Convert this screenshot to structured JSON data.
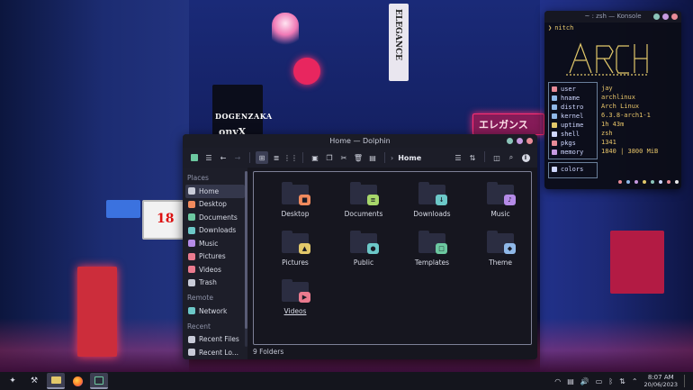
{
  "wallpaper": {
    "signs": [
      "DOGENZAKA",
      "onyX",
      "エレガンス",
      "18",
      "ELEGANCE"
    ]
  },
  "konsole": {
    "title": "~ : zsh — Konsole",
    "prompt_symbol": "❯",
    "command": "nitch",
    "window_button_colors": [
      "#8bc4b9",
      "#c79ae0",
      "#e88b97"
    ],
    "info": [
      {
        "key": "user",
        "icon": "user-icon",
        "color": "#e88b97",
        "value": "jay"
      },
      {
        "key": "hname",
        "icon": "hash-icon",
        "color": "#8fb8e8",
        "value": "archlinux"
      },
      {
        "key": "distro",
        "icon": "distro-icon",
        "color": "#8fb8e8",
        "value": "Arch Linux"
      },
      {
        "key": "kernel",
        "icon": "kernel-icon",
        "color": "#8fb8e8",
        "value": "6.3.8-arch1-1"
      },
      {
        "key": "uptime",
        "icon": "clock-icon",
        "color": "#e2c86a",
        "value": "1h 43m"
      },
      {
        "key": "shell",
        "icon": "shell-icon",
        "color": "#cfd7ff",
        "value": "zsh"
      },
      {
        "key": "pkgs",
        "icon": "package-icon",
        "color": "#e88b97",
        "value": "1341"
      },
      {
        "key": "memory",
        "icon": "memory-icon",
        "color": "#c79ae0",
        "value": "1840 | 3800 MiB"
      }
    ],
    "colors_label": "colors",
    "swatches": [
      "#e88b97",
      "#8fb8e8",
      "#c79ae0",
      "#e2c86a",
      "#8bc4b9",
      "#cfd7ff",
      "#e88b97",
      "#eaeaea"
    ]
  },
  "dolphin": {
    "title": "Home — Dolphin",
    "window_button_colors": [
      "#8bc4b9",
      "#c79ae0",
      "#e88b97"
    ],
    "path": "Home",
    "places_label": "Places",
    "places": [
      {
        "label": "Home",
        "icon": "home-icon",
        "color": "#c8cbd8",
        "selected": true
      },
      {
        "label": "Desktop",
        "icon": "desktop-icon",
        "color": "#f08a5d",
        "selected": false
      },
      {
        "label": "Documents",
        "icon": "documents-icon",
        "color": "#6cc8a0",
        "selected": false
      },
      {
        "label": "Downloads",
        "icon": "downloads-icon",
        "color": "#6cc8c8",
        "selected": false
      },
      {
        "label": "Music",
        "icon": "music-icon",
        "color": "#b58be8",
        "selected": false
      },
      {
        "label": "Pictures",
        "icon": "pictures-icon",
        "color": "#ea7a8e",
        "selected": false
      },
      {
        "label": "Videos",
        "icon": "videos-icon",
        "color": "#ea7a8e",
        "selected": false
      },
      {
        "label": "Trash",
        "icon": "trash-icon",
        "color": "#c8cbd8",
        "selected": false
      }
    ],
    "remote_label": "Remote",
    "remote": [
      {
        "label": "Network",
        "icon": "network-icon",
        "color": "#6cc8c8"
      }
    ],
    "recent_label": "Recent",
    "recent": [
      {
        "label": "Recent Files",
        "icon": "recent-files-icon",
        "color": "#c8cbd8"
      },
      {
        "label": "Recent Lo...",
        "icon": "recent-locations-icon",
        "color": "#c8cbd8"
      }
    ],
    "folders": [
      {
        "label": "Desktop",
        "icon": "desktop-folder-icon",
        "badge_color": "#f08a5d",
        "glyph": "■"
      },
      {
        "label": "Documents",
        "icon": "documents-folder-icon",
        "badge_color": "#a7d76a",
        "glyph": "≡"
      },
      {
        "label": "Downloads",
        "icon": "downloads-folder-icon",
        "badge_color": "#6cc8c8",
        "glyph": "↓"
      },
      {
        "label": "Music",
        "icon": "music-folder-icon",
        "badge_color": "#b58be8",
        "glyph": "♪"
      },
      {
        "label": "Pictures",
        "icon": "pictures-folder-icon",
        "badge_color": "#e2c86a",
        "glyph": "▲"
      },
      {
        "label": "Public",
        "icon": "public-folder-icon",
        "badge_color": "#6cc8c8",
        "glyph": "●"
      },
      {
        "label": "Templates",
        "icon": "templates-folder-icon",
        "badge_color": "#6cc8a0",
        "glyph": "□"
      },
      {
        "label": "Theme",
        "icon": "theme-folder-icon",
        "badge_color": "#8fb8e8",
        "glyph": "◆"
      },
      {
        "label": "Videos",
        "icon": "videos-folder-icon",
        "badge_color": "#ea7a8e",
        "glyph": "▶"
      }
    ],
    "status": "9 Folders"
  },
  "taskbar": {
    "time": "8:07 AM",
    "date": "20/06/2023"
  }
}
